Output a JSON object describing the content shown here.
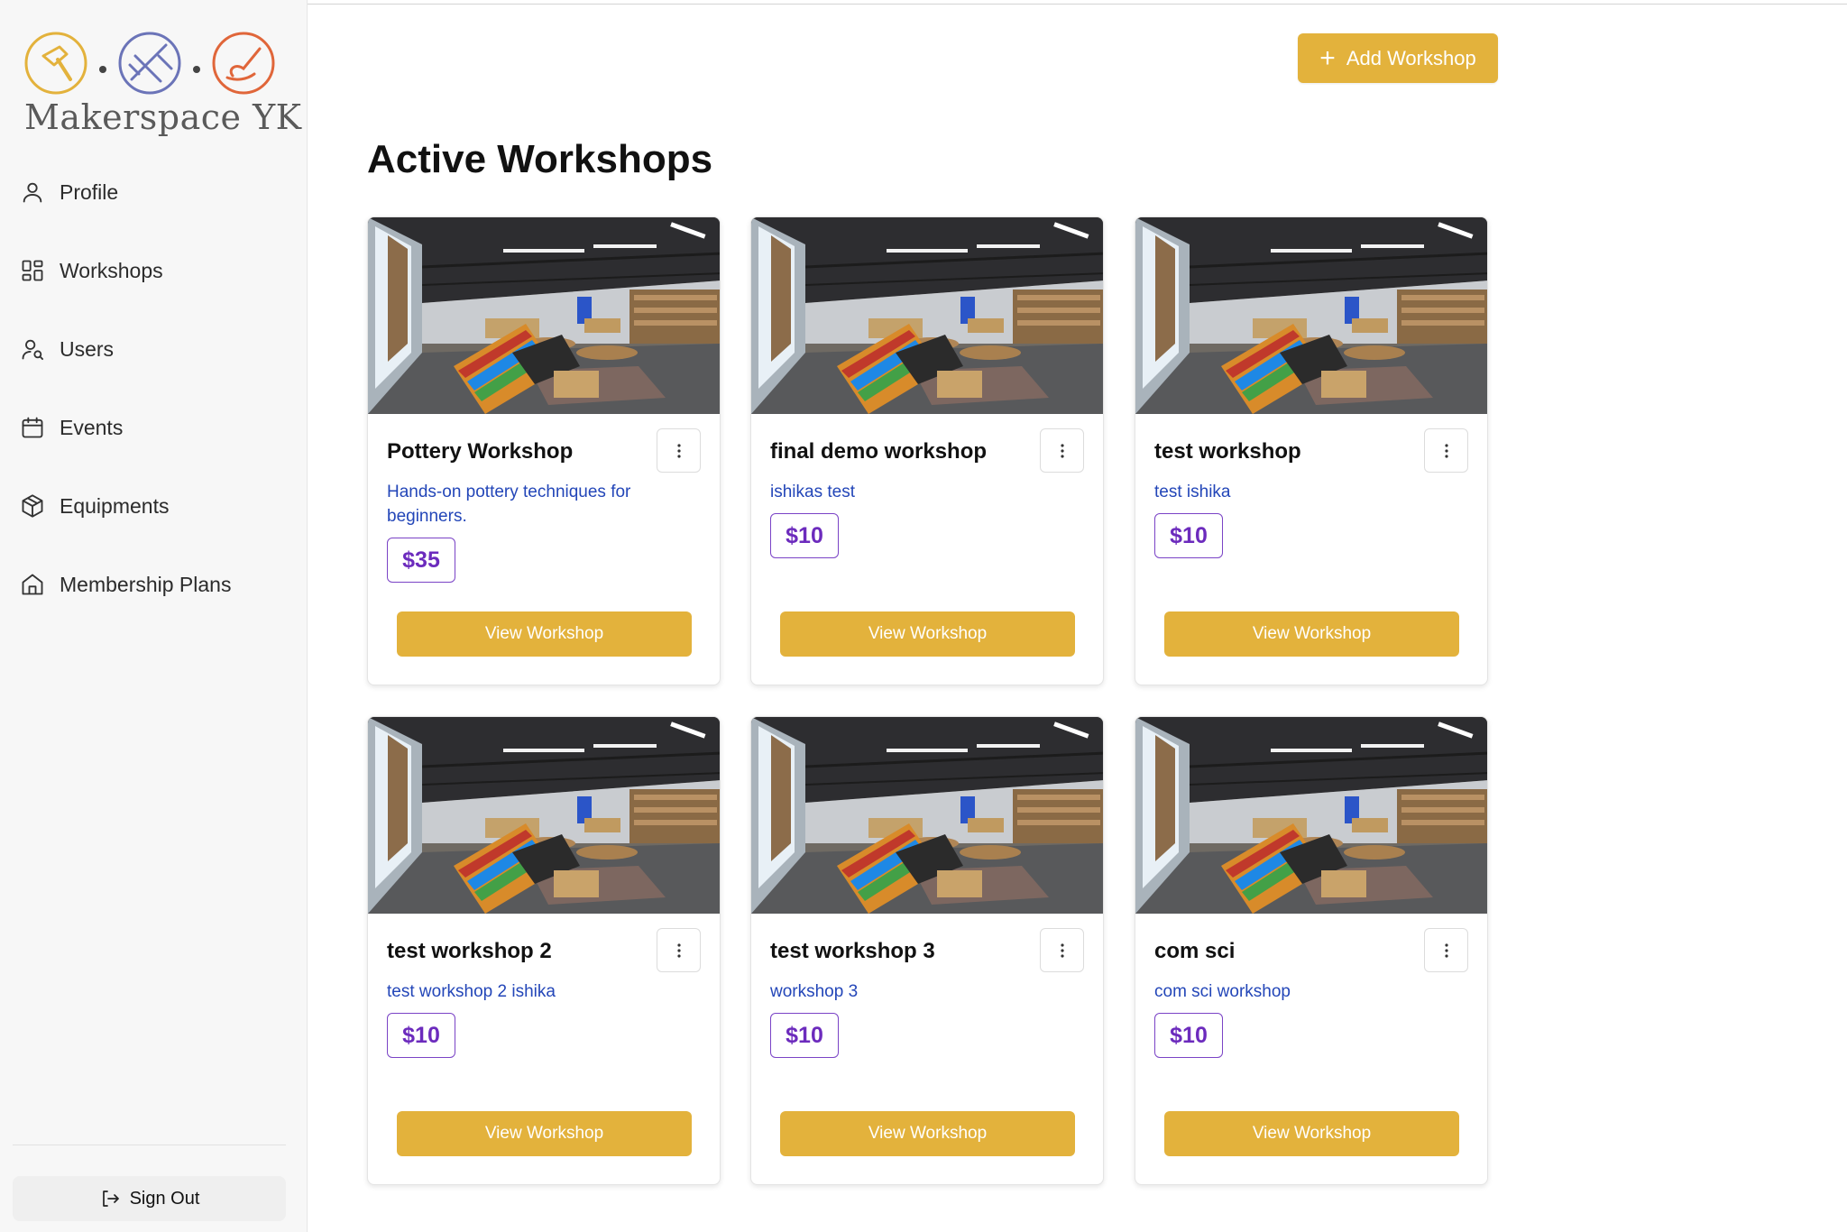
{
  "app": {
    "logo_text": "Makerspace YK"
  },
  "sidebar": {
    "items": [
      {
        "label": "Profile",
        "icon": "user-icon"
      },
      {
        "label": "Workshops",
        "icon": "dashboard-icon"
      },
      {
        "label": "Users",
        "icon": "user-search-icon"
      },
      {
        "label": "Events",
        "icon": "calendar-icon"
      },
      {
        "label": "Equipments",
        "icon": "box-icon"
      },
      {
        "label": "Membership Plans",
        "icon": "home-icon"
      }
    ],
    "sign_out": "Sign Out"
  },
  "header": {
    "add_button": "Add Workshop"
  },
  "main": {
    "title": "Active Workshops",
    "view_button_label": "View Workshop",
    "workshops": [
      {
        "title": "Pottery Workshop",
        "description": "Hands-on pottery techniques for beginners.",
        "price": "$35"
      },
      {
        "title": "final demo workshop",
        "description": "ishikas test",
        "price": "$10"
      },
      {
        "title": "test workshop",
        "description": "test ishika",
        "price": "$10"
      },
      {
        "title": "test workshop 2",
        "description": "test workshop 2 ishika",
        "price": "$10"
      },
      {
        "title": "test workshop 3",
        "description": "workshop 3",
        "price": "$10"
      },
      {
        "title": "com sci",
        "description": "com sci workshop",
        "price": "$10"
      }
    ]
  },
  "colors": {
    "accent": "#e3b23c",
    "price": "#6c2bbd",
    "description": "#2346b8"
  }
}
